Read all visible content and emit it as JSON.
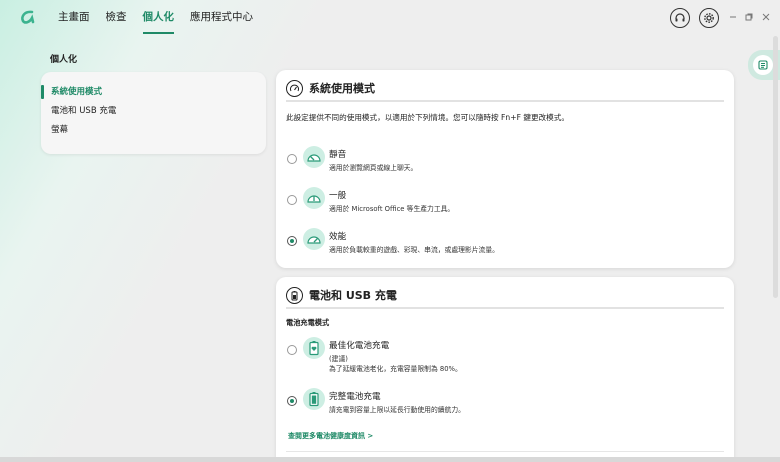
{
  "nav": {
    "items": [
      "主畫面",
      "檢查",
      "個人化",
      "應用程式中心"
    ],
    "active_index": 2
  },
  "window_controls": [
    "headset-icon",
    "gear-icon",
    "minimize",
    "restore",
    "close"
  ],
  "section_title": "個人化",
  "sidebar": {
    "items": [
      "系統使用模式",
      "電池和 USB 充電",
      "螢幕"
    ],
    "active_index": 0
  },
  "usage_mode": {
    "title": "系統使用模式",
    "description": "此設定提供不同的使用模式，以適用於下列情境。您可以隨時按 Fn+F 鍵更改模式。",
    "options": [
      {
        "title": "靜音",
        "subtitle": "適用於瀏覽網頁或線上聊天。",
        "selected": false
      },
      {
        "title": "一般",
        "subtitle": "適用於 Microsoft Office 等生產力工具。",
        "selected": false
      },
      {
        "title": "效能",
        "subtitle": "適用於負載較重的遊戲、彩現、串流，或處理影片流量。",
        "selected": true
      }
    ]
  },
  "battery": {
    "title": "電池和 USB 充電",
    "subheading": "電池充電模式",
    "options": [
      {
        "title": "最佳化電池充電",
        "subtitle1": "(建議)",
        "subtitle2": "為了延緩電池老化，充電容量限制為 80%。",
        "selected": false
      },
      {
        "title": "完整電池充電",
        "subtitle1": "請充電到容量上限以延長行動使用的續航力。",
        "subtitle2": "",
        "selected": true
      }
    ],
    "link": "查閱更多電池健康度資訊 >"
  },
  "colors": {
    "accent": "#1f8a67",
    "icon_bg": "#cdeee3"
  }
}
